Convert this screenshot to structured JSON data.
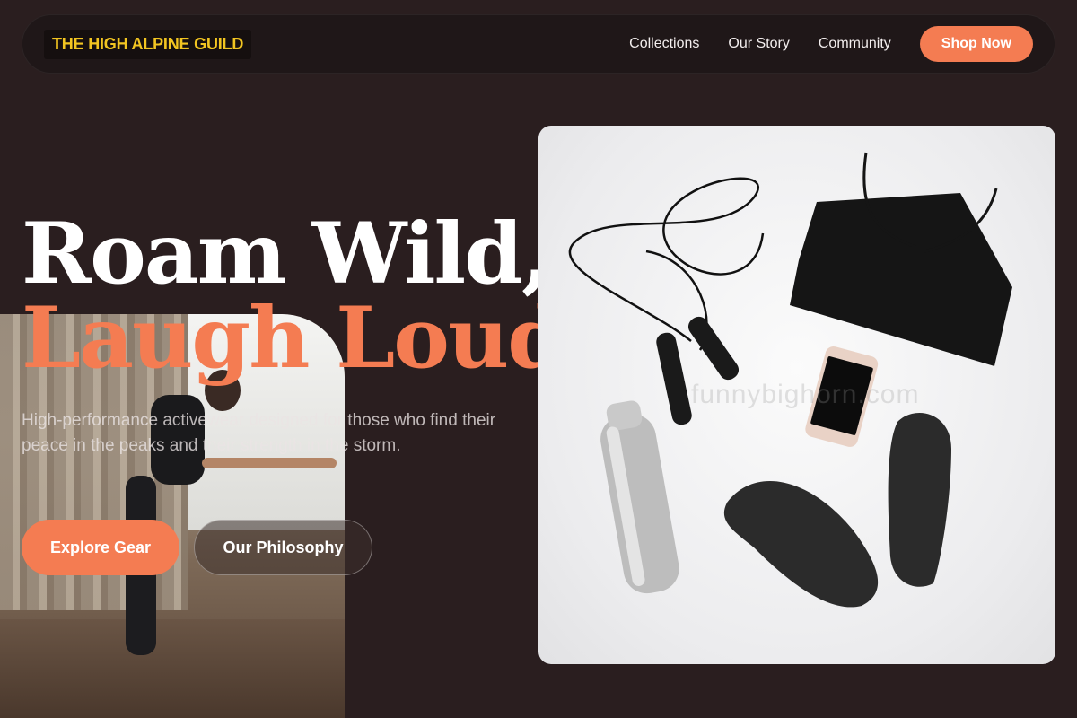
{
  "brand": {
    "name": "THE HIGH ALPINE GUILD"
  },
  "nav": {
    "links": [
      "Collections",
      "Our Story",
      "Community"
    ],
    "cta": "Shop Now"
  },
  "hero": {
    "line1": "Roam Wild,",
    "line2": "Laugh Loud.",
    "subtext": "High-performance activewear designed for those who find their peace in the peaks and their strength in the storm.",
    "primary_button": "Explore Gear",
    "secondary_button": "Our Philosophy"
  },
  "product_image": {
    "watermark": "funnybighorn.com"
  },
  "colors": {
    "background": "#2a1e1f",
    "accent": "#f47c52",
    "logo_text": "#f2c521"
  }
}
